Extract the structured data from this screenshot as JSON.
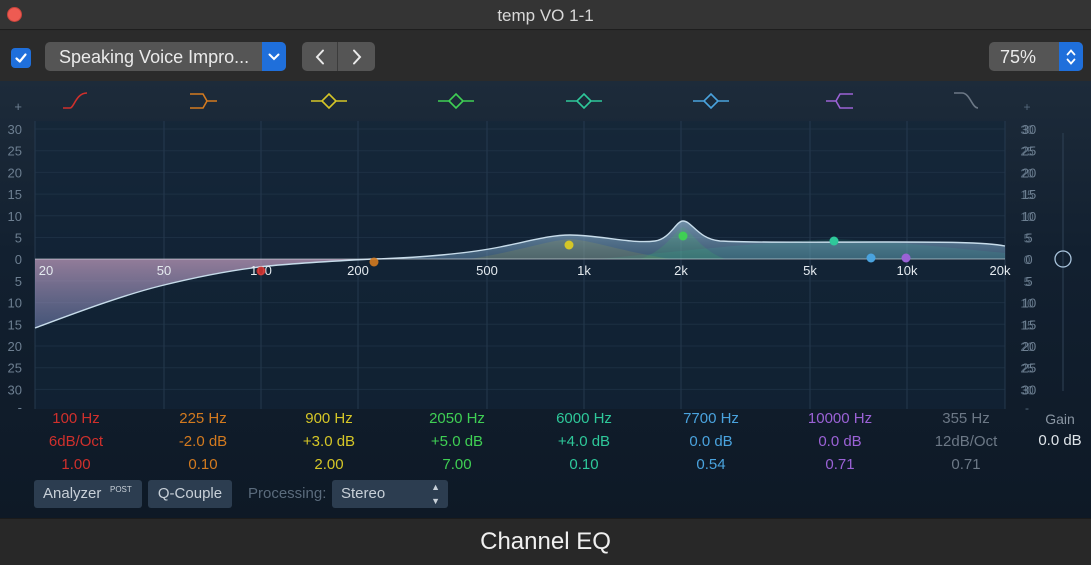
{
  "window": {
    "title": "temp VO 1-1"
  },
  "toolbar": {
    "plugin_enabled": true,
    "preset": "Speaking Voice Impro...",
    "zoom": "75%"
  },
  "colors": {
    "accent": "#1f6fdb",
    "close_button": "#ee5b52",
    "band1": "#d0302c",
    "band2": "#d37a1f",
    "band3": "#d5c627",
    "band4": "#3fcf54",
    "band5": "#2ec89a",
    "band6": "#4aa3de",
    "band7": "#9b62d6",
    "band8": "#6c7886"
  },
  "graph": {
    "db_scale_left": [
      "+",
      "30",
      "25",
      "20",
      "15",
      "10",
      "5",
      "0",
      "5",
      "10",
      "15",
      "20",
      "25",
      "30",
      "-"
    ],
    "db_scale_right_inner": [
      "+",
      "30",
      "25",
      "20",
      "15",
      "10",
      "5",
      "0",
      "5",
      "10",
      "15",
      "20",
      "25",
      "30",
      "-"
    ],
    "db_scale_right": [
      "30",
      "25",
      "20",
      "15",
      "10",
      "5",
      "0",
      "5",
      "10",
      "15",
      "20",
      "25",
      "30"
    ],
    "freq_labels": [
      "20",
      "50",
      "100",
      "200",
      "500",
      "1k",
      "2k",
      "5k",
      "10k",
      "20k"
    ],
    "band_types": [
      "low-cut",
      "low-shelf",
      "peak",
      "peak",
      "peak",
      "peak",
      "high-shelf",
      "high-cut"
    ]
  },
  "bands": [
    {
      "freq": "100 Hz",
      "gain": "6dB/Oct",
      "q": "1.00",
      "color": "#d0302c"
    },
    {
      "freq": "225 Hz",
      "gain": "-2.0 dB",
      "q": "0.10",
      "color": "#d37a1f"
    },
    {
      "freq": "900 Hz",
      "gain": "+3.0 dB",
      "q": "2.00",
      "color": "#d5c627"
    },
    {
      "freq": "2050 Hz",
      "gain": "+5.0 dB",
      "q": "7.00",
      "color": "#3fcf54"
    },
    {
      "freq": "6000 Hz",
      "gain": "+4.0 dB",
      "q": "0.10",
      "color": "#2ec89a"
    },
    {
      "freq": "7700 Hz",
      "gain": "0.0 dB",
      "q": "0.54",
      "color": "#4aa3de"
    },
    {
      "freq": "10000 Hz",
      "gain": "0.0 dB",
      "q": "0.71",
      "color": "#9b62d6"
    },
    {
      "freq": "355 Hz",
      "gain": "12dB/Oct",
      "q": "0.71",
      "color": "#6c7886"
    }
  ],
  "gain": {
    "label": "Gain",
    "value": "0.0 dB"
  },
  "controls": {
    "analyzer": "Analyzer",
    "analyzer_badge": "POST",
    "q_couple": "Q-Couple",
    "processing_label": "Processing:",
    "processing_value": "Stereo"
  },
  "footer": {
    "plugin_name": "Channel EQ"
  }
}
